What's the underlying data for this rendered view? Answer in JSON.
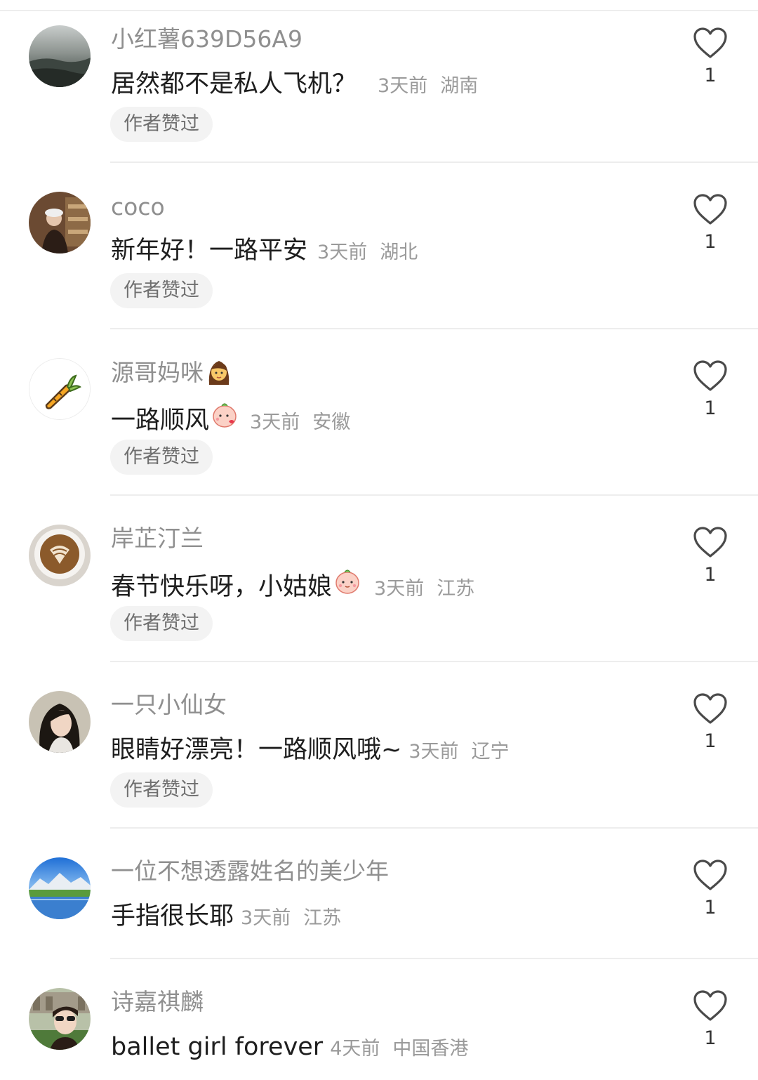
{
  "comments": [
    {
      "username": "小红薯639D56A9",
      "content": "居然都不是私人飞机？",
      "emoji": "",
      "time": "3天前",
      "location": "湖南",
      "badge": "作者赞过",
      "likes": "1"
    },
    {
      "username": "coco",
      "content": "新年好！一路平安",
      "emoji": "",
      "time": "3天前",
      "location": "湖北",
      "badge": "作者赞过",
      "likes": "1"
    },
    {
      "username": "源哥妈咪",
      "content": "一路顺风",
      "emoji": "blowing-kiss-emoji",
      "time": "3天前",
      "location": "安徽",
      "badge": "作者赞过",
      "likes": "1"
    },
    {
      "username": "岸芷汀兰",
      "content": "春节快乐呀，小姑娘",
      "emoji": "peach-face-emoji",
      "time": "3天前",
      "location": "江苏",
      "badge": "作者赞过",
      "likes": "1"
    },
    {
      "username": "一只小仙女",
      "content": "眼睛好漂亮！一路顺风哦~",
      "emoji": "",
      "time": "3天前",
      "location": "辽宁",
      "badge": "作者赞过",
      "likes": "1"
    },
    {
      "username": "一位不想透露姓名的美少年",
      "content": "手指很长耶",
      "emoji": "",
      "time": "3天前",
      "location": "江苏",
      "badge": "",
      "likes": "1"
    },
    {
      "username": "诗嘉祺麟",
      "content": "ballet girl forever",
      "emoji": "",
      "time": "4天前",
      "location": "中国香港",
      "badge": "",
      "likes": "1"
    }
  ],
  "icons": {
    "like": "heart-outline-icon",
    "username_emoji_3": "woman-emoji"
  },
  "colors": {
    "username": "#8f8f8f",
    "meta": "#9a9a9a",
    "badge_bg": "#f3f3f3",
    "divider": "#ededed"
  }
}
